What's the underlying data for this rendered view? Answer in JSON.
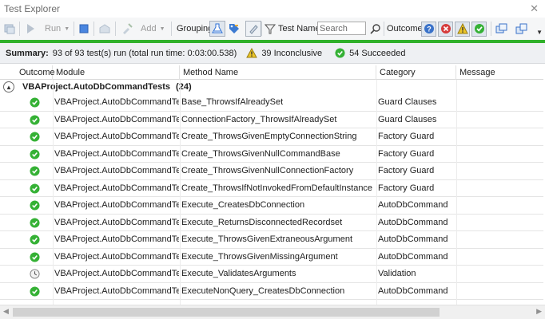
{
  "window": {
    "title": "Test Explorer"
  },
  "toolbar": {
    "run_label": "Run",
    "add_label": "Add",
    "grouping_label": "Grouping",
    "test_name_label": "Test Name",
    "search_placeholder": "Search",
    "outcome_label": "Outcome"
  },
  "progress": {
    "fraction": 1.0,
    "color": "#2fb02a"
  },
  "summary": {
    "label": "Summary:",
    "run_text": "93 of 93 test(s) run (total run time: 0:03:00.538)",
    "inconclusive_text": "39 Inconclusive",
    "succeeded_text": "54 Succeeded"
  },
  "columns": [
    "Outcome",
    "Module",
    "Method Name",
    "Category",
    "Message"
  ],
  "group": {
    "name": "VBAProject.AutoDbCommandTests",
    "count": "(24)"
  },
  "rows": [
    {
      "outcome": "success",
      "module": "VBAProject.AutoDbCommandTests",
      "method": "Base_ThrowsIfAlreadySet",
      "category": "Guard Clauses",
      "message": ""
    },
    {
      "outcome": "success",
      "module": "VBAProject.AutoDbCommandTests",
      "method": "ConnectionFactory_ThrowsIfAlreadySet",
      "category": "Guard Clauses",
      "message": ""
    },
    {
      "outcome": "success",
      "module": "VBAProject.AutoDbCommandTests",
      "method": "Create_ThrowsGivenEmptyConnectionString",
      "category": "Factory Guard",
      "message": ""
    },
    {
      "outcome": "success",
      "module": "VBAProject.AutoDbCommandTests",
      "method": "Create_ThrowsGivenNullCommandBase",
      "category": "Factory Guard",
      "message": ""
    },
    {
      "outcome": "success",
      "module": "VBAProject.AutoDbCommandTests",
      "method": "Create_ThrowsGivenNullConnectionFactory",
      "category": "Factory Guard",
      "message": ""
    },
    {
      "outcome": "success",
      "module": "VBAProject.AutoDbCommandTests",
      "method": "Create_ThrowsIfNotInvokedFromDefaultInstance",
      "category": "Factory Guard",
      "message": ""
    },
    {
      "outcome": "success",
      "module": "VBAProject.AutoDbCommandTests",
      "method": "Execute_CreatesDbConnection",
      "category": "AutoDbCommand",
      "message": ""
    },
    {
      "outcome": "success",
      "module": "VBAProject.AutoDbCommandTests",
      "method": "Execute_ReturnsDisconnectedRecordset",
      "category": "AutoDbCommand",
      "message": ""
    },
    {
      "outcome": "success",
      "module": "VBAProject.AutoDbCommandTests",
      "method": "Execute_ThrowsGivenExtraneousArgument",
      "category": "AutoDbCommand",
      "message": ""
    },
    {
      "outcome": "success",
      "module": "VBAProject.AutoDbCommandTests",
      "method": "Execute_ThrowsGivenMissingArgument",
      "category": "AutoDbCommand",
      "message": ""
    },
    {
      "outcome": "pending",
      "module": "VBAProject.AutoDbCommandTests",
      "method": "Execute_ValidatesArguments",
      "category": "Validation",
      "message": ""
    },
    {
      "outcome": "success",
      "module": "VBAProject.AutoDbCommandTests",
      "method": "ExecuteNonQuery_CreatesDbConnection",
      "category": "AutoDbCommand",
      "message": ""
    }
  ],
  "icons": {
    "success": "check-circle-icon",
    "pending": "clock-icon"
  },
  "colors": {
    "success": "#35b135",
    "inconclusive": "#e8c51a",
    "accent": "#2b6fd6"
  }
}
